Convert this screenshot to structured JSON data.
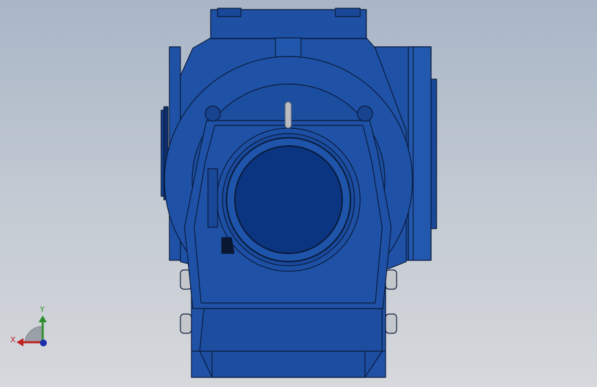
{
  "colors": {
    "background_top": "#a9b6c7",
    "background_bottom": "#d6d8dc",
    "model_body": "#1f52a6",
    "model_dark": "#0b3580",
    "model_edge": "#0a1a3a",
    "shaft": "#b9bcc2",
    "axis_x": "#c02020",
    "axis_y": "#2f8f2f",
    "axis_z": "#1a2fb0"
  },
  "triad": {
    "x_label": "X",
    "y_label": "Y"
  },
  "icons": {
    "triad": "coordinate-triad-icon"
  }
}
